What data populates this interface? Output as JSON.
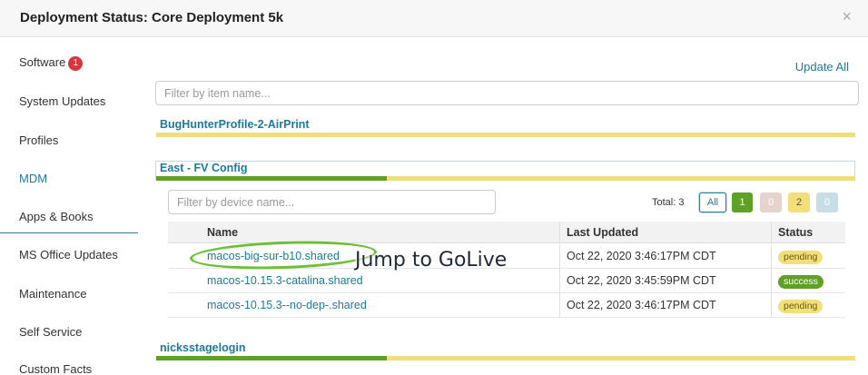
{
  "modal": {
    "title": "Deployment Status: Core Deployment 5k",
    "close": "×"
  },
  "sidebar": {
    "items": [
      {
        "label": "Software",
        "badge": "1"
      },
      {
        "label": "System Updates"
      },
      {
        "label": "Profiles"
      },
      {
        "label": "MDM",
        "active": true
      },
      {
        "label": "Apps & Books"
      },
      {
        "label": "MS Office Updates"
      },
      {
        "label": "Maintenance"
      },
      {
        "label": "Self Service"
      },
      {
        "label": "Custom Facts"
      }
    ]
  },
  "main": {
    "update_all_label": "Update All",
    "filter_items_placeholder": "Filter by item name...",
    "groups": [
      {
        "title": "BugHunterProfile-2-AirPrint",
        "success_fraction": 0.0
      },
      {
        "title": "East - FV Config",
        "success_fraction": 0.33
      },
      {
        "title": "nicksstagelogin",
        "success_fraction": 0.33
      }
    ],
    "device_filter": {
      "placeholder": "Filter by device name...",
      "total_label": "Total: 3",
      "all_label": "All",
      "success_count": "1",
      "failed_count": "0",
      "pending_count": "2",
      "other_count": "0"
    },
    "table": {
      "headers": {
        "name": "Name",
        "last_updated": "Last Updated",
        "status": "Status"
      },
      "rows": [
        {
          "name": "macos-big-sur-b10.shared",
          "last_updated": "Oct 22, 2020 3:46:17PM CDT",
          "status": "pending"
        },
        {
          "name": "macos-10.15.3-catalina.shared",
          "last_updated": "Oct 22, 2020 3:45:59PM CDT",
          "status": "success"
        },
        {
          "name": "macos-10.15.3--no-dep-.shared",
          "last_updated": "Oct 22, 2020 3:46:17PM CDT",
          "status": "pending"
        }
      ]
    }
  },
  "annotation": {
    "text": "Jump to GoLive",
    "color": "#6cc035"
  },
  "colors": {
    "accent": "#1f7a99",
    "success": "#5fa126",
    "pending": "#f2df7a",
    "badge": "#d9363e"
  }
}
